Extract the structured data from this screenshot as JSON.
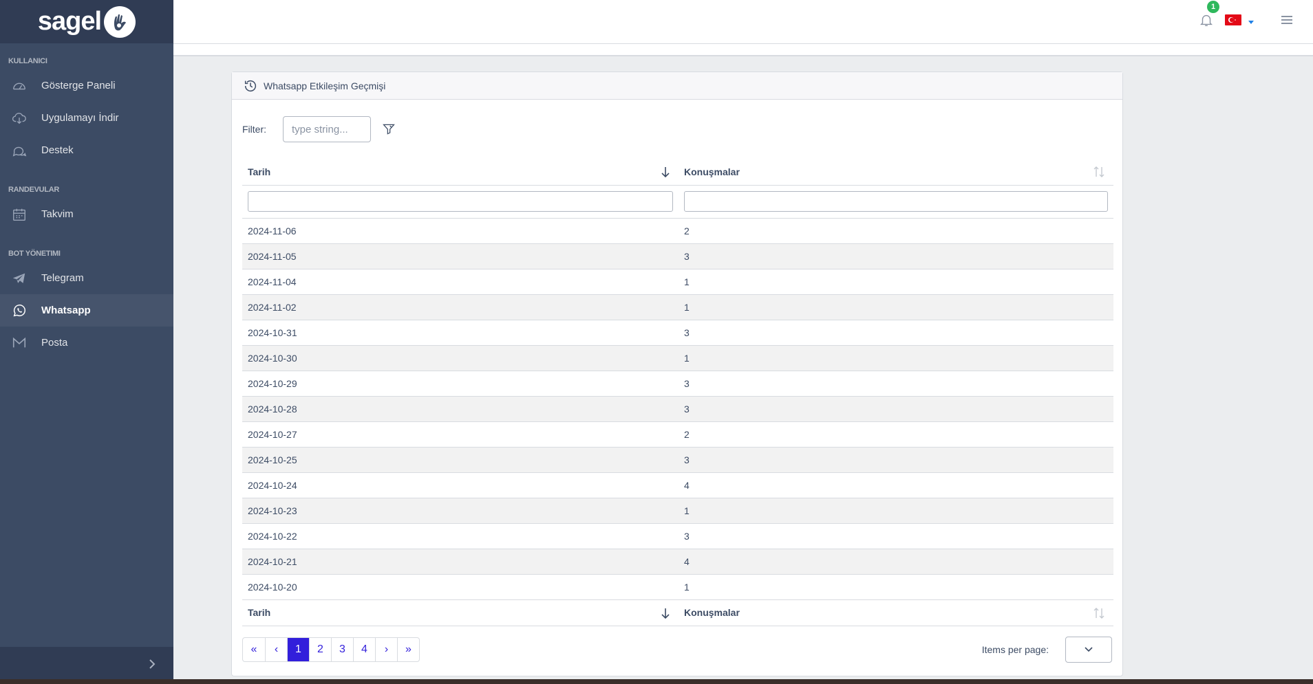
{
  "brand": {
    "name": "sagel"
  },
  "sidebar": {
    "sections": [
      {
        "title": "KULLANICI",
        "items": [
          {
            "label": "Gösterge Paneli",
            "icon": "speedometer-icon"
          },
          {
            "label": "Uygulamayı İndir",
            "icon": "cloud-download-icon"
          },
          {
            "label": "Destek",
            "icon": "chat-icon"
          }
        ]
      },
      {
        "title": "RANDEVULAR",
        "items": [
          {
            "label": "Takvim",
            "icon": "calendar-icon"
          }
        ]
      },
      {
        "title": "BOT YÖNETIMI",
        "items": [
          {
            "label": "Telegram",
            "icon": "telegram-icon"
          },
          {
            "label": "Whatsapp",
            "icon": "whatsapp-icon",
            "active": true
          },
          {
            "label": "Posta",
            "icon": "mail-icon"
          }
        ]
      }
    ]
  },
  "header": {
    "notification_count": "1",
    "language_flag": "TR"
  },
  "card": {
    "title": "Whatsapp Etkileşim Geçmişi",
    "filter_label": "Filter:",
    "filter_placeholder": "type string...",
    "columns": [
      "Tarih",
      "Konuşmalar"
    ],
    "rows": [
      [
        "2024-11-06",
        "2"
      ],
      [
        "2024-11-05",
        "3"
      ],
      [
        "2024-11-04",
        "1"
      ],
      [
        "2024-11-02",
        "1"
      ],
      [
        "2024-10-31",
        "3"
      ],
      [
        "2024-10-30",
        "1"
      ],
      [
        "2024-10-29",
        "3"
      ],
      [
        "2024-10-28",
        "3"
      ],
      [
        "2024-10-27",
        "2"
      ],
      [
        "2024-10-25",
        "3"
      ],
      [
        "2024-10-24",
        "4"
      ],
      [
        "2024-10-23",
        "1"
      ],
      [
        "2024-10-22",
        "3"
      ],
      [
        "2024-10-21",
        "4"
      ],
      [
        "2024-10-20",
        "1"
      ]
    ],
    "pagination": {
      "first": "«",
      "prev": "‹",
      "pages": [
        "1",
        "2",
        "3",
        "4"
      ],
      "current": "1",
      "next": "›",
      "last": "»"
    },
    "items_per_page_label": "Items per page:"
  },
  "colors": {
    "sidebar": "#3c4b64",
    "brand_bg": "#303c54",
    "accent": "#321fdb",
    "badge": "#2eb85c"
  }
}
